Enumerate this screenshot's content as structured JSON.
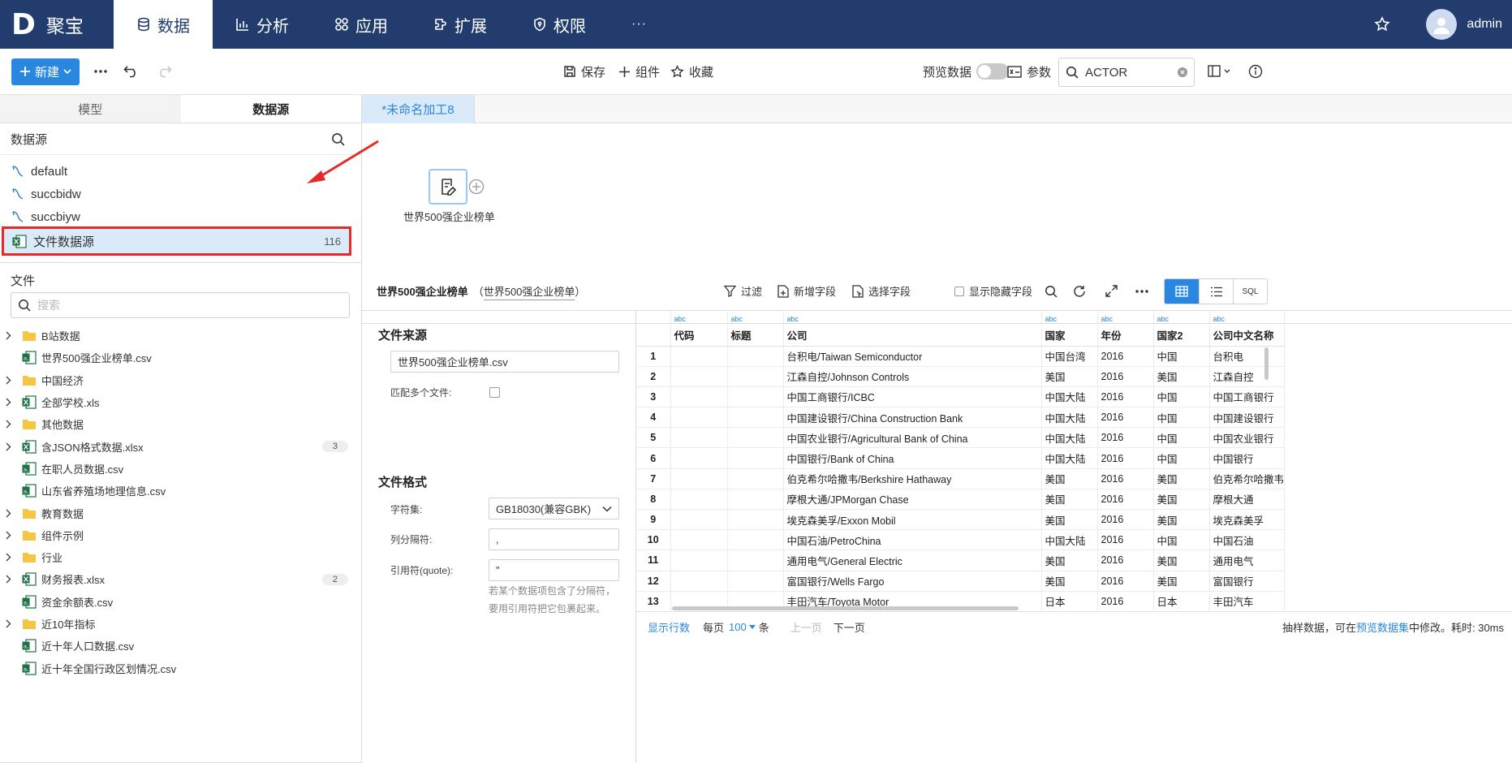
{
  "brand": {
    "logo_letter": "D",
    "name": "聚宝"
  },
  "nav": {
    "tabs": [
      {
        "label": "数据",
        "icon": "database-icon"
      },
      {
        "label": "分析",
        "icon": "bar-chart-icon"
      },
      {
        "label": "应用",
        "icon": "apps-icon"
      },
      {
        "label": "扩展",
        "icon": "extension-icon"
      },
      {
        "label": "权限",
        "icon": "shield-icon"
      }
    ],
    "more": "···",
    "user": "admin"
  },
  "toolbar": {
    "new_label": "新建",
    "save_label": "保存",
    "component_label": "组件",
    "favorite_label": "收藏",
    "preview_label": "预览数据",
    "params_label": "参数",
    "search_value": "ACTOR"
  },
  "left": {
    "tabs": [
      "模型",
      "数据源"
    ],
    "datasource_header": "数据源",
    "datasources": [
      {
        "name": "default"
      },
      {
        "name": "succbidw"
      },
      {
        "name": "succbiyw"
      },
      {
        "name": "文件数据源",
        "count": "116"
      }
    ],
    "file_header": "文件",
    "search_placeholder": "搜索",
    "tree": [
      {
        "name": "B站数据",
        "type": "folder",
        "expandable": true
      },
      {
        "name": "世界500强企业榜单.csv",
        "type": "csv",
        "expandable": false
      },
      {
        "name": "中国经济",
        "type": "folder",
        "expandable": true
      },
      {
        "name": "全部学校.xls",
        "type": "excel",
        "expandable": true
      },
      {
        "name": "其他数据",
        "type": "folder",
        "expandable": true
      },
      {
        "name": "含JSON格式数据.xlsx",
        "type": "excel",
        "expandable": true,
        "count": "3"
      },
      {
        "name": "在职人员数据.csv",
        "type": "csv",
        "expandable": false
      },
      {
        "name": "山东省养殖场地理信息.csv",
        "type": "csv",
        "expandable": false
      },
      {
        "name": "教育数据",
        "type": "folder",
        "expandable": true
      },
      {
        "name": "组件示例",
        "type": "folder",
        "expandable": true
      },
      {
        "name": "行业",
        "type": "folder",
        "expandable": true
      },
      {
        "name": "财务报表.xlsx",
        "type": "excel",
        "expandable": true,
        "count": "2"
      },
      {
        "name": "资金余额表.csv",
        "type": "csv",
        "expandable": false
      },
      {
        "name": "近10年指标",
        "type": "folder",
        "expandable": true
      },
      {
        "name": "近十年人口数据.csv",
        "type": "csv",
        "expandable": false
      },
      {
        "name": "近十年全国行政区划情况.csv",
        "type": "csv",
        "expandable": false
      }
    ]
  },
  "workspace": {
    "tab_label": "*未命名加工8",
    "node_label": "世界500强企业榜单"
  },
  "detail": {
    "title": "世界500强企业榜单",
    "paren_open": "（",
    "subtitle": "世界500强企业榜单",
    "paren_close": "）",
    "filter_label": "过滤",
    "add_field_label": "新增字段",
    "select_field_label": "选择字段",
    "show_hidden_label": "显示隐藏字段",
    "sql_label": "SQL"
  },
  "config": {
    "source_title": "文件来源",
    "file_value": "世界500强企业榜单.csv",
    "match_multi_label": "匹配多个文件:",
    "format_title": "文件格式",
    "charset_label": "字符集:",
    "charset_value": "GB18030(兼容GBK)",
    "sep_label": "列分隔符:",
    "sep_value": ",",
    "quote_label": "引用符(quote):",
    "quote_value": "\"",
    "quote_hint": "若某个数据项包含了分隔符，要用引用符把它包裹起来。"
  },
  "grid": {
    "columns": [
      {
        "type": "abc",
        "name": "代码"
      },
      {
        "type": "abc",
        "name": "标题"
      },
      {
        "type": "abc",
        "name": "公司"
      },
      {
        "type": "abc",
        "name": "国家"
      },
      {
        "type": "abc",
        "name": "年份"
      },
      {
        "type": "abc",
        "name": "国家2"
      },
      {
        "type": "abc",
        "name": "公司中文名称"
      }
    ],
    "rows": [
      [
        "1",
        "",
        "",
        "台积电/Taiwan Semiconductor",
        "中国台湾",
        "2016",
        "中国",
        "台积电"
      ],
      [
        "2",
        "",
        "",
        "江森自控/Johnson Controls",
        "美国",
        "2016",
        "美国",
        "江森自控"
      ],
      [
        "3",
        "",
        "",
        "中国工商银行/ICBC",
        "中国大陆",
        "2016",
        "中国",
        "中国工商银行"
      ],
      [
        "4",
        "",
        "",
        "中国建设银行/China Construction Bank",
        "中国大陆",
        "2016",
        "中国",
        "中国建设银行"
      ],
      [
        "5",
        "",
        "",
        "中国农业银行/Agricultural Bank of China",
        "中国大陆",
        "2016",
        "中国",
        "中国农业银行"
      ],
      [
        "6",
        "",
        "",
        "中国银行/Bank of China",
        "中国大陆",
        "2016",
        "中国",
        "中国银行"
      ],
      [
        "7",
        "",
        "",
        "伯克希尔哈撒韦/Berkshire Hathaway",
        "美国",
        "2016",
        "美国",
        "伯克希尔哈撒韦"
      ],
      [
        "8",
        "",
        "",
        "摩根大通/JPMorgan Chase",
        "美国",
        "2016",
        "美国",
        "摩根大通"
      ],
      [
        "9",
        "",
        "",
        "埃克森美孚/Exxon Mobil",
        "美国",
        "2016",
        "美国",
        "埃克森美孚"
      ],
      [
        "10",
        "",
        "",
        "中国石油/PetroChina",
        "中国大陆",
        "2016",
        "中国",
        "中国石油"
      ],
      [
        "11",
        "",
        "",
        "通用电气/General Electric",
        "美国",
        "2016",
        "美国",
        "通用电气"
      ],
      [
        "12",
        "",
        "",
        "富国银行/Wells Fargo",
        "美国",
        "2016",
        "美国",
        "富国银行"
      ],
      [
        "13",
        "",
        "",
        "丰田汽车/Toyota Motor",
        "日本",
        "2016",
        "日本",
        "丰田汽车"
      ]
    ]
  },
  "footer": {
    "show_rows": "显示行数",
    "per_page": "每页",
    "page_size": "100",
    "unit": "条",
    "prev": "上一页",
    "next": "下一页",
    "sample_prefix": "抽样数据，可在",
    "preview_link": "预览数据集",
    "sample_suffix": "中修改。耗时: 30ms"
  },
  "colors": {
    "nav_bg": "#213c6d",
    "accent": "#2a87df",
    "highlight_border": "#e52a2a",
    "selection_bg": "#dbeaf8"
  }
}
